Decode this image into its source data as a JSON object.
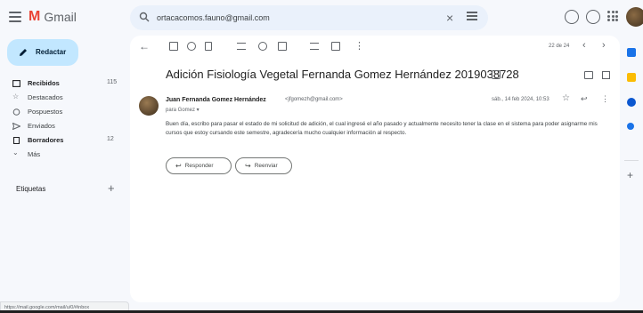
{
  "app": {
    "logo_text": "Gmail"
  },
  "search": {
    "value": "ortacacomos.fauno@gmail.com"
  },
  "sidebar": {
    "compose_label": "Redactar",
    "items": [
      {
        "label": "Recibidos",
        "count": "115",
        "bold": true,
        "icon": "inbox-icon"
      },
      {
        "label": "Destacados",
        "count": "",
        "bold": false,
        "icon": "star-icon"
      },
      {
        "label": "Pospuestos",
        "count": "",
        "bold": false,
        "icon": "clock-icon"
      },
      {
        "label": "Enviados",
        "count": "",
        "bold": false,
        "icon": "send-icon"
      },
      {
        "label": "Borradores",
        "count": "12",
        "bold": true,
        "icon": "draft-icon"
      },
      {
        "label": "Más",
        "count": "",
        "bold": false,
        "icon": "chevron-down-icon"
      }
    ],
    "labels_title": "Etiquetas"
  },
  "toolbar": {
    "pagination": "22 de 24"
  },
  "email": {
    "subject": "Adición Fisiología Vegetal Fernanda Gomez Hernández 2019038728",
    "sender_name": "Juan Fernanda Gomez Hernández",
    "sender_email": "<jfgomezh@gmail.com>",
    "recipient": "para Gomez ▾",
    "date": "sáb., 14 feb 2024, 10:53",
    "body": "Buen día, escribo para pasar el estado de mi solicitud de adición, el cual ingresé el año pasado y actualmente necesito tener la clase en el sistema para poder asignarme mis cursos que estoy cursando este semestre, agradecería mucho cualquier información al respecto.",
    "reply_label": "Responder",
    "forward_label": "Reenviar"
  },
  "status_bar": {
    "url": "https://mail.google.com/mail/u/0/#inbox"
  },
  "colors": {
    "compose_bg": "#c2e7ff",
    "page_bg": "#f6f8fc",
    "search_bg": "#eaf1fb",
    "gmail_red": "#ea4335",
    "rail_blue": "#1a73e8",
    "rail_yellow": "#fbbc04",
    "rail_teal": "#0b57d0"
  }
}
